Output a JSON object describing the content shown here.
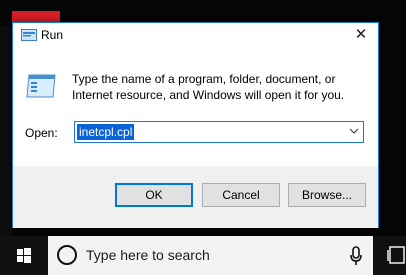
{
  "window": {
    "title": "Run",
    "close_glyph": "✕",
    "description": "Type the name of a program, folder, document, or Internet resource, and Windows will open it for you."
  },
  "open_field": {
    "label": "Open:",
    "value": "inetcpl.cpl"
  },
  "buttons": {
    "ok": "OK",
    "cancel": "Cancel",
    "browse": "Browse..."
  },
  "taskbar": {
    "search_placeholder": "Type here to search"
  },
  "colors": {
    "accent": "#0078d7",
    "selection": "#0a64d8",
    "desktop_red": "#d61f26"
  },
  "icons": [
    "run-icon",
    "run-app-icon",
    "close-icon",
    "chevron-down-icon",
    "windows-logo-icon",
    "cortana-circle-icon",
    "microphone-icon",
    "task-view-icon"
  ]
}
